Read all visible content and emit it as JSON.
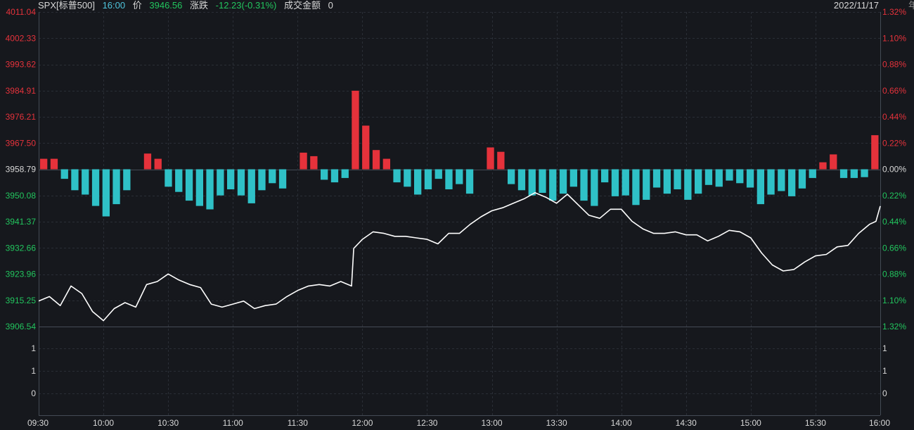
{
  "header": {
    "symbol": "SPX[标普500]",
    "time": "16:00",
    "price_label": "价",
    "price": "3946.56",
    "change_label": "涨跌",
    "change": "-12.23(-0.31%)",
    "volume_label": "成交金额",
    "volume": "0",
    "date": "2022/11/17"
  },
  "colors": {
    "background": "#16181d",
    "grid": "#2a2e36",
    "up": "#e5323b",
    "down": "#2fc1c7",
    "price_line": "#ffffff",
    "neutral": "#d8d8d8"
  },
  "chart_data": {
    "type": "line",
    "base_price": 3958.79,
    "ylim": [
      3906.54,
      4011.04
    ],
    "y_ticks_left": [
      "4011.04",
      "4002.33",
      "3993.62",
      "3984.91",
      "3976.21",
      "3967.50",
      "3958.79",
      "3950.08",
      "3941.37",
      "3932.66",
      "3923.96",
      "3915.25",
      "3906.54"
    ],
    "y_ticks_right": [
      "1.32%",
      "1.10%",
      "0.88%",
      "0.66%",
      "0.44%",
      "0.22%",
      "0.00%",
      "0.22%",
      "0.44%",
      "0.66%",
      "0.88%",
      "1.10%",
      "1.32%"
    ],
    "x_ticks": [
      "09:30",
      "10:00",
      "10:30",
      "11:00",
      "11:30",
      "12:00",
      "12:30",
      "13:00",
      "13:30",
      "14:00",
      "14:30",
      "15:00",
      "15:30",
      "16:00"
    ],
    "series": [
      {
        "x": [
          "09:30",
          "09:35",
          "09:40",
          "09:45",
          "09:50",
          "09:55",
          "10:00",
          "10:05",
          "10:10",
          "10:15",
          "10:20",
          "10:25",
          "10:30",
          "10:35",
          "10:40",
          "10:45",
          "10:50",
          "10:55",
          "11:00",
          "11:05",
          "11:10",
          "11:15",
          "11:20",
          "11:25",
          "11:30",
          "11:35",
          "11:40",
          "11:45",
          "11:50",
          "11:55",
          "11:56",
          "12:00",
          "12:05",
          "12:10",
          "12:15",
          "12:20",
          "12:25",
          "12:30",
          "12:35",
          "12:40",
          "12:45",
          "12:50",
          "12:55",
          "13:00",
          "13:05",
          "13:10",
          "13:15",
          "13:20",
          "13:25",
          "13:30",
          "13:35",
          "13:40",
          "13:45",
          "13:50",
          "13:55",
          "14:00",
          "14:05",
          "14:10",
          "14:15",
          "14:20",
          "14:25",
          "14:30",
          "14:35",
          "14:40",
          "14:45",
          "14:50",
          "14:55",
          "15:00",
          "15:05",
          "15:10",
          "15:15",
          "15:20",
          "15:25",
          "15:30",
          "15:35",
          "15:40",
          "15:45",
          "15:50",
          "15:55",
          "15:58",
          "16:00"
        ],
        "values": [
          3915.0,
          3916.5,
          3913.5,
          3920.0,
          3917.5,
          3911.5,
          3908.5,
          3912.5,
          3914.5,
          3913.0,
          3920.5,
          3921.5,
          3924.0,
          3922.0,
          3920.5,
          3919.5,
          3914.0,
          3913.0,
          3914.0,
          3915.0,
          3912.5,
          3913.5,
          3914.0,
          3916.5,
          3918.5,
          3920.0,
          3920.5,
          3920.0,
          3921.5,
          3920.0,
          3932.5,
          3935.5,
          3938.0,
          3937.5,
          3936.5,
          3936.5,
          3936.0,
          3935.5,
          3934.0,
          3937.5,
          3937.5,
          3940.5,
          3943.0,
          3945.0,
          3946.0,
          3947.5,
          3949.0,
          3951.0,
          3949.5,
          3947.5,
          3950.5,
          3947.0,
          3943.5,
          3942.5,
          3945.5,
          3945.5,
          3941.5,
          3939.0,
          3937.5,
          3937.5,
          3938.0,
          3937.0,
          3937.0,
          3935.0,
          3936.5,
          3938.5,
          3938.0,
          3936.0,
          3931.0,
          3927.0,
          3925.0,
          3925.5,
          3928.0,
          3930.0,
          3930.5,
          3933.0,
          3933.5,
          3937.5,
          3940.5,
          3941.5,
          3946.56
        ]
      }
    ],
    "bars": [
      24,
      24,
      -22,
      -48,
      -58,
      -84,
      -108,
      -80,
      -48,
      0,
      36,
      24,
      -40,
      -52,
      -72,
      -84,
      -92,
      -60,
      -46,
      -60,
      -78,
      -48,
      -32,
      -44,
      0,
      38,
      30,
      -24,
      -30,
      -20,
      180,
      100,
      44,
      24,
      -30,
      -40,
      -58,
      -46,
      -22,
      -46,
      -34,
      -56,
      0,
      50,
      40,
      -34,
      -48,
      -60,
      -54,
      -72,
      -56,
      -40,
      -72,
      -84,
      -30,
      -62,
      -60,
      -82,
      -70,
      -42,
      -56,
      -46,
      -70,
      -56,
      -36,
      -40,
      -26,
      -32,
      -42,
      -80,
      -58,
      -50,
      -62,
      -44,
      -20,
      16,
      34,
      -20,
      -20,
      -18,
      78
    ]
  },
  "sub_panel": {
    "left_ticks": [
      "1",
      "1",
      "0"
    ],
    "right_ticks": [
      "1",
      "1",
      "0"
    ]
  },
  "edge_clip_text": "年"
}
